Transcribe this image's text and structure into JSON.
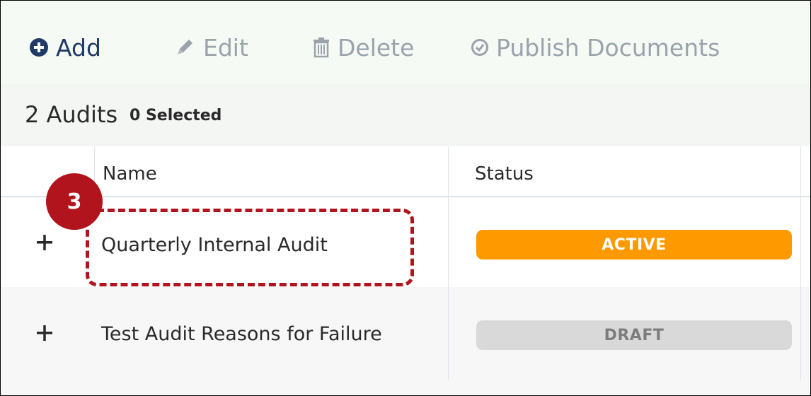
{
  "toolbar": {
    "add_label": "Add",
    "edit_label": "Edit",
    "delete_label": "Delete",
    "publish_label": "Publish Documents"
  },
  "summary": {
    "count_label": "2 Audits",
    "selected_label": "0 Selected"
  },
  "table": {
    "columns": [
      "Name",
      "Status"
    ],
    "rows": [
      {
        "name": "Quarterly Internal Audit",
        "status": "ACTIVE"
      },
      {
        "name": "Test Audit Reasons for Failure",
        "status": "DRAFT"
      }
    ]
  },
  "callout": {
    "number": "3"
  },
  "colors": {
    "active": "#ff9900",
    "draft": "#d9d9d9",
    "callout": "#b2141d",
    "primary": "#1f3a66",
    "muted": "#9aa2ac"
  },
  "icons": {
    "add": "plus-circle-icon",
    "edit": "pencil-icon",
    "delete": "trash-icon",
    "publish": "check-circle-icon",
    "expand": "plus-icon"
  }
}
